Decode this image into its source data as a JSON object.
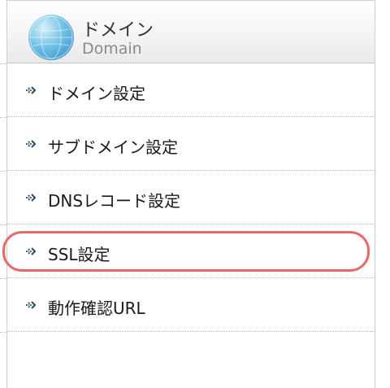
{
  "header": {
    "icon": "globe-icon",
    "title": "ドメイン",
    "subtitle": "Domain"
  },
  "menu": {
    "items": [
      {
        "label": "ドメイン設定"
      },
      {
        "label": "サブドメイン設定"
      },
      {
        "label": "DNSレコード設定"
      },
      {
        "label": "SSL設定",
        "highlighted": true
      },
      {
        "label": "動作確認URL"
      }
    ],
    "arrow_icon": "double-arrow-icon"
  },
  "colors": {
    "highlight": "#e56a6a",
    "arrow": "#2a4a5a"
  }
}
